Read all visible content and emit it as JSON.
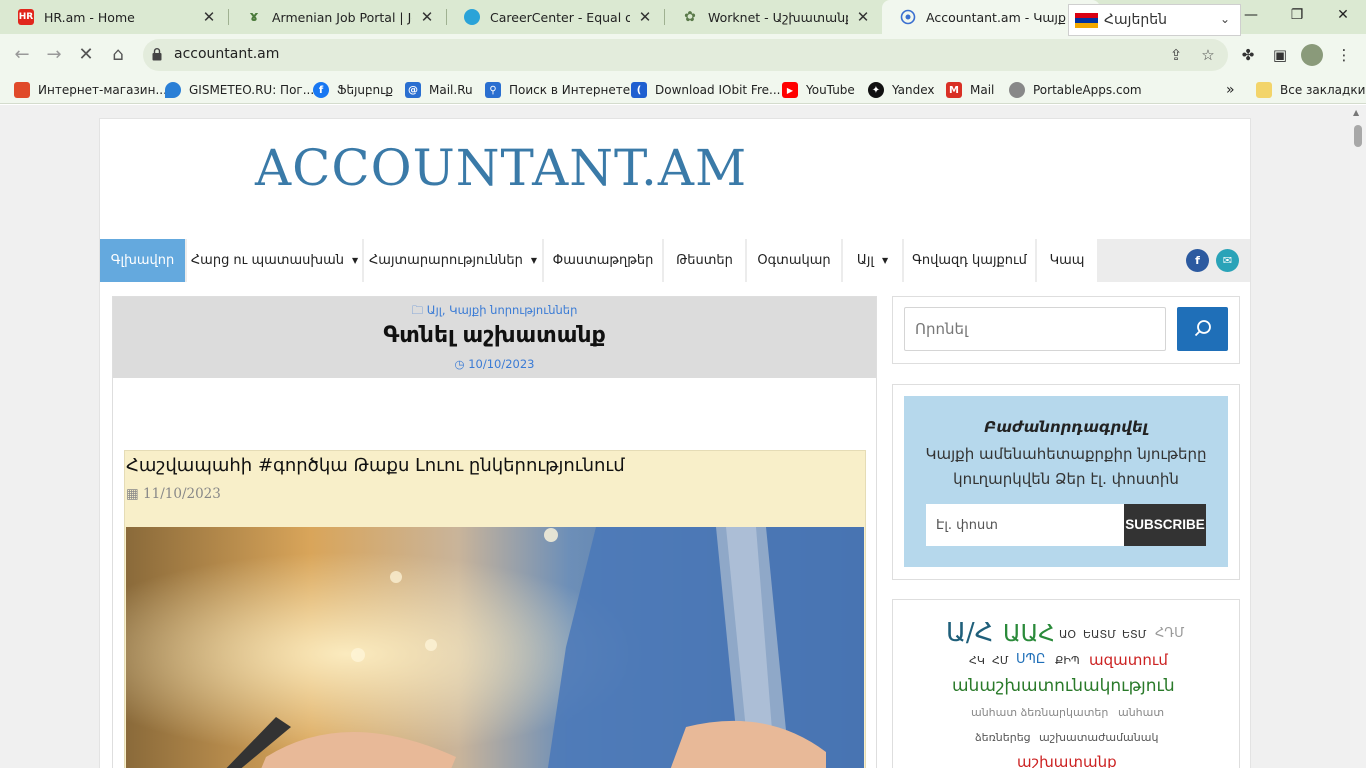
{
  "browser": {
    "tabs": [
      {
        "title": "HR.am - Home",
        "favicon": "hr-logo-icon",
        "favicon_text": "HR",
        "favicon_color": "#e1261c"
      },
      {
        "title": "Armenian Job Portal | Jobs in",
        "favicon": "job-portal-icon",
        "favicon_text": "",
        "favicon_color": "#4a7a3a"
      },
      {
        "title": "CareerCenter - Equal opport",
        "favicon": "cloud-icon",
        "favicon_text": "",
        "favicon_color": "#2aa3d8"
      },
      {
        "title": "Worknet - Աշխատանքայի",
        "favicon": "worknet-icon",
        "favicon_text": "",
        "favicon_color": "#5a7a4a"
      },
      {
        "title": "Accountant.am - Կայք հաշ",
        "favicon": "globe-icon",
        "favicon_text": "",
        "favicon_color": "#3a6fd0"
      }
    ],
    "url": "accountant.am",
    "bookmarks": [
      {
        "label": "Интернет-магазин...",
        "icon": "store-icon",
        "color": "#e04a2a"
      },
      {
        "label": "GISMETEO.RU: Пог...",
        "icon": "drop-icon",
        "color": "#2a7fd6"
      },
      {
        "label": "Ֆեյսբուք",
        "icon": "facebook-icon",
        "color": "#1877f2"
      },
      {
        "label": "Mail.Ru",
        "icon": "at-icon",
        "color": "#2a6fd0"
      },
      {
        "label": "Поиск в Интернете",
        "icon": "search-icon",
        "color": "#2a6fd0"
      },
      {
        "label": "Download IObit Fre...",
        "icon": "iobit-icon",
        "color": "#1f5fd0"
      },
      {
        "label": "YouTube",
        "icon": "youtube-icon",
        "color": "#ff0000"
      },
      {
        "label": "Yandex",
        "icon": "yandex-icon",
        "color": "#111111"
      },
      {
        "label": "Mail",
        "icon": "gmail-icon",
        "color": "#d93025"
      },
      {
        "label": "PortableApps.com",
        "icon": "portableapps-icon",
        "color": "#888888"
      }
    ],
    "all_bookmarks": "Все закладки"
  },
  "site": {
    "language": "Հայերեն",
    "logo": "ACCOUNTANT.AM",
    "nav": [
      {
        "label": "Գլխավոր",
        "dropdown": false
      },
      {
        "label": "Հարց ու պատասխան",
        "dropdown": true
      },
      {
        "label": "Հայտարարություններ",
        "dropdown": true
      },
      {
        "label": "Փաստաթղթեր",
        "dropdown": false
      },
      {
        "label": "Թեստեր",
        "dropdown": false
      },
      {
        "label": "Օգտակար",
        "dropdown": false
      },
      {
        "label": "Այլ",
        "dropdown": true
      },
      {
        "label": "Գովազդ կայքում",
        "dropdown": false
      },
      {
        "label": "Կապ",
        "dropdown": false
      }
    ],
    "post": {
      "category": "Այլ, Կայքի նորություններ",
      "title": "Գտնել աշխատանք",
      "date": "10/10/2023"
    },
    "article": {
      "title": "Հաշվապահի #գործկա Թաքս Լուու ընկերությունում",
      "date": "11/10/2023"
    },
    "search": {
      "placeholder": "Որոնել"
    },
    "subscribe": {
      "heading": "Բաժանորդագրվել",
      "description": "Կայքի ամենահետաքրքիր նյութերը կուղարկվեն Ձեր էլ. փոստին",
      "email_placeholder": "Էլ. փոստ",
      "button": "SUBSCRIBE"
    },
    "tags": [
      {
        "text": "Ա/Հ",
        "size": 26,
        "color": "#1f5f7a"
      },
      {
        "text": "ԱԱՀ",
        "size": 24,
        "color": "#2a8a3a"
      },
      {
        "text": "ԱՕ",
        "size": 11,
        "color": "#333333"
      },
      {
        "text": "ԵԱՏՄ",
        "size": 11,
        "color": "#333333"
      },
      {
        "text": "ԵՏՄ",
        "size": 11,
        "color": "#333333"
      },
      {
        "text": "ՀԴՄ",
        "size": 12,
        "color": "#999999"
      },
      {
        "text": "ՀԿ",
        "size": 11,
        "color": "#333333"
      },
      {
        "text": "ՀՄ",
        "size": 11,
        "color": "#333333"
      },
      {
        "text": "ՍՊԸ",
        "size": 13,
        "color": "#1f6fb8"
      },
      {
        "text": "ՔԻՊ",
        "size": 11,
        "color": "#333333"
      },
      {
        "text": "ազատում",
        "size": 15,
        "color": "#cc2222"
      },
      {
        "text": "անաշխատունակություն",
        "size": 18,
        "color": "#2a7a2a"
      },
      {
        "text": "անհատ ձեռնարկատեր",
        "size": 11,
        "color": "#888888"
      },
      {
        "text": "անհատ",
        "size": 11,
        "color": "#888888"
      },
      {
        "text": "ձեռներեց",
        "size": 11,
        "color": "#555555"
      },
      {
        "text": "աշխատաժամանակ",
        "size": 11,
        "color": "#555555"
      },
      {
        "text": "աշխատանք",
        "size": 15,
        "color": "#cc2222"
      }
    ]
  }
}
